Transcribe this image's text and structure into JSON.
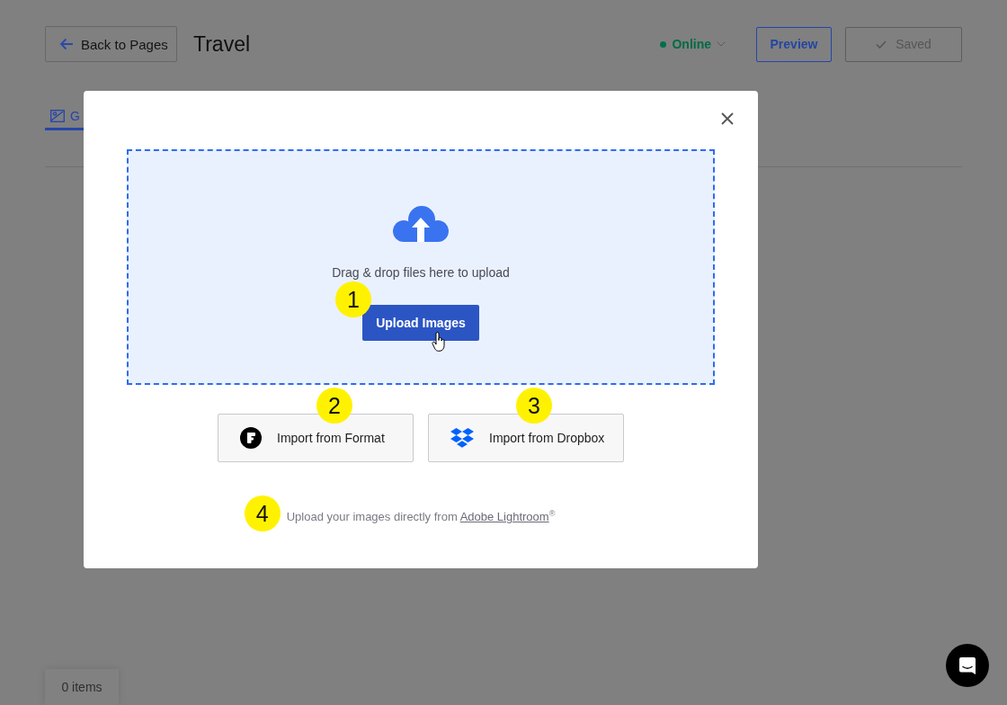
{
  "header": {
    "back_button": "Back to Pages",
    "title": "Travel",
    "status": "Online",
    "preview_button": "Preview",
    "saved_button": {
      "label": "Saved",
      "disabled": true
    }
  },
  "tabs": [
    {
      "label": "G",
      "selected": true
    }
  ],
  "item_count": "0 items",
  "dialog": {
    "dropzone": {
      "text": "Drag & drop files here to upload",
      "button": "Upload Images",
      "callout": "1"
    },
    "imports": [
      {
        "kind": "format",
        "label": "Import from Format",
        "callout": "2"
      },
      {
        "kind": "dropbox",
        "label": "Import from Dropbox",
        "callout": "3"
      }
    ],
    "note": {
      "text": "Upload your images directly from ",
      "link": "Adobe Lightroom",
      "suffix": "$^{®}$",
      "callout": "4"
    }
  }
}
